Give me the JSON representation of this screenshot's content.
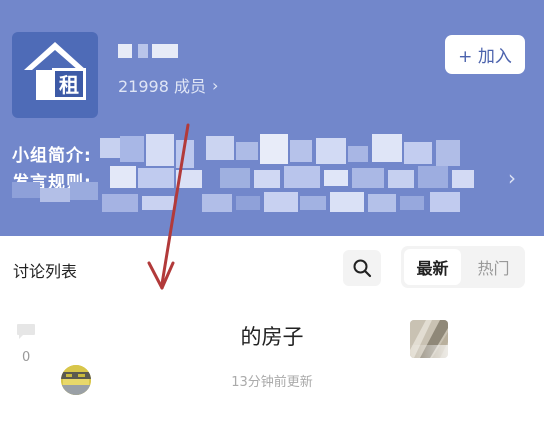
{
  "header": {
    "member_count": "21998 成员",
    "member_chevron": "›",
    "join_button": "+ 加入",
    "intro_label": "小组简介:",
    "rules_label": "发言规则:",
    "intro_chevron": "›",
    "logo_char": "租",
    "colors": {
      "banner": "#7287cb",
      "logo": "#4e6bb7",
      "accent": "#4c63ad"
    }
  },
  "discussion": {
    "section_title": "讨论列表",
    "sort_latest": "最新",
    "sort_hot": "热门",
    "search_icon": "search-icon"
  },
  "post": {
    "comment_count": "0",
    "title": "的房子",
    "updated": "13分钟前更新"
  },
  "annotation": {
    "color": "#b23a3a",
    "icon": "red-arrow-annotation"
  }
}
